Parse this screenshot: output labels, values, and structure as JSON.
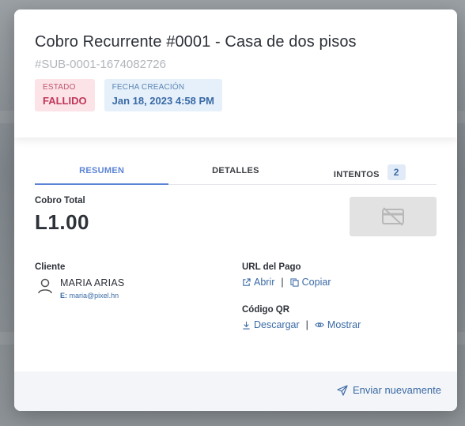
{
  "background": {
    "partial_text": "MARIA ARIAS"
  },
  "modal": {
    "title": "Cobro Recurrente #0001 - Casa de dos pisos",
    "sub_id": "#SUB-0001-1674082726",
    "status": {
      "label": "ESTADO",
      "value": "FALLIDO",
      "color": "#c0365a"
    },
    "created": {
      "label": "FECHA CREACIÓN",
      "value": "Jan 18, 2023 4:58 PM",
      "color": "#3a6aa5"
    }
  },
  "tabs": [
    {
      "label": "RESUMEN",
      "active": true
    },
    {
      "label": "DETALLES",
      "active": false
    },
    {
      "label": "INTENTOS",
      "active": false,
      "count": "2"
    }
  ],
  "summary": {
    "total_label": "Cobro Total",
    "total_value": "L1.00",
    "card_icon": "credit-card-off-icon"
  },
  "client": {
    "label": "Cliente",
    "name": "MARIA ARIAS",
    "email_prefix": "E:",
    "email": "maria@pixel.hn"
  },
  "payment_url": {
    "label": "URL del Pago",
    "open_label": "Abrir",
    "copy_label": "Copiar"
  },
  "qr": {
    "label": "Código QR",
    "download_label": "Descargar",
    "show_label": "Mostrar"
  },
  "footer": {
    "resend_label": "Enviar nuevamente"
  },
  "colors": {
    "accent": "#5b84d6",
    "link": "#3a6aa5",
    "danger": "#c0365a"
  }
}
